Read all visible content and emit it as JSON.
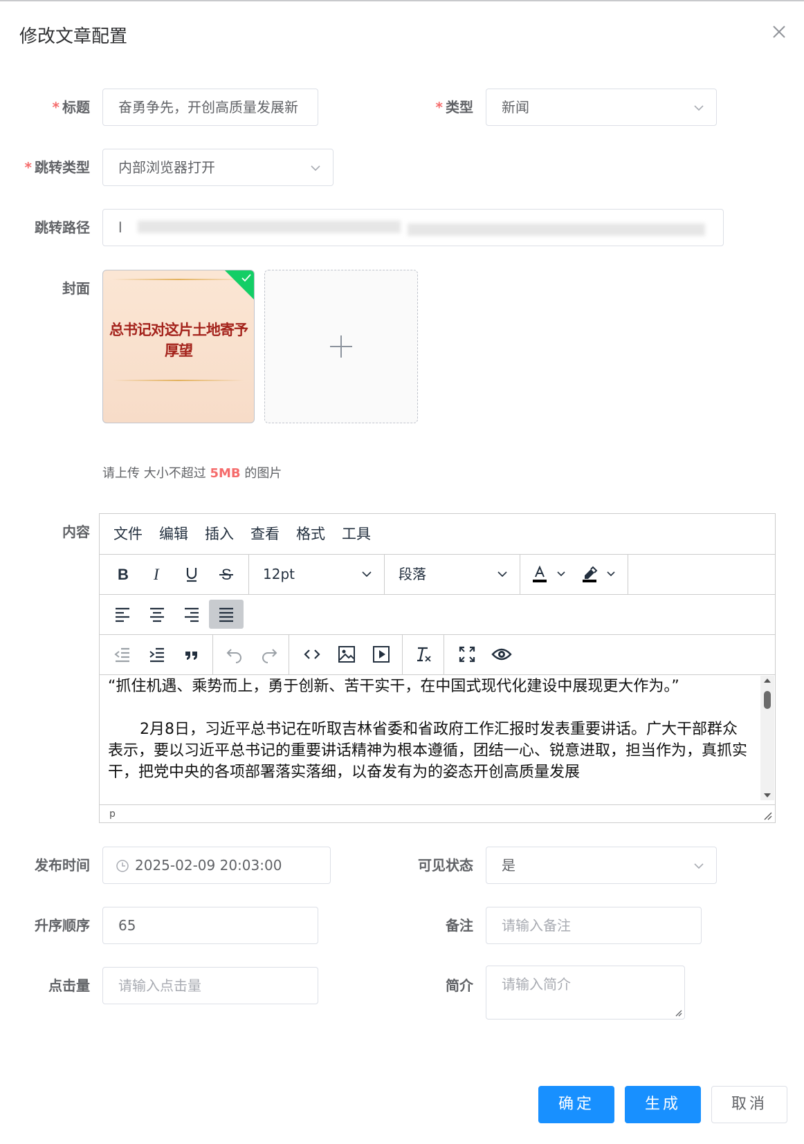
{
  "dialog": {
    "title": "修改文章配置"
  },
  "form": {
    "title_label": "标题",
    "title_value": "奋勇争先，开创高质量发展新",
    "type_label": "类型",
    "type_value": "新闻",
    "jump_type_label": "跳转类型",
    "jump_type_value": "内部浏览器打开",
    "jump_path_label": "跳转路径",
    "jump_path_value": "l",
    "cover_label": "封面",
    "cover_image_text": "总书记对这片土地寄予厚望",
    "upload_tip_prefix": "请上传 大小不超过",
    "upload_tip_size": "5MB",
    "upload_tip_suffix": "的图片",
    "content_label": "内容",
    "publish_time_label": "发布时间",
    "publish_time_value": "2025-02-09 20:03:00",
    "visible_label": "可见状态",
    "visible_value": "是",
    "sort_label": "升序顺序",
    "sort_value": "65",
    "remark_label": "备注",
    "remark_placeholder": "请输入备注",
    "clicks_label": "点击量",
    "clicks_placeholder": "请输入点击量",
    "intro_label": "简介",
    "intro_placeholder": "请输入简介"
  },
  "editor": {
    "menu": [
      "文件",
      "编辑",
      "插入",
      "查看",
      "格式",
      "工具"
    ],
    "font_size": "12pt",
    "block_format": "段落",
    "content_paragraph_1": "“抓住机遇、乘势而上，勇于创新、苦干实干，在中国式现代化建设中展现更大作为。”",
    "content_paragraph_2": "2月8日，习近平总书记在听取吉林省委和省政府工作汇报时发表重要讲话。广大干部群众表示，要以习近平总书记的重要讲话精神为根本遵循，团结一心、锐意进取，担当作为，真抓实干，把党中央的各项部署落实落细，以奋发有为的姿态开创高质量发展",
    "status_path": "p"
  },
  "buttons": {
    "confirm": "确定",
    "generate": "生成",
    "cancel": "取消"
  },
  "colors": {
    "primary": "#1890ff",
    "required": "#f56c6c",
    "cover_badge": "#13ce66"
  },
  "icons": [
    "close-icon",
    "chevron-down-icon",
    "check-icon",
    "plus-icon",
    "clock-icon"
  ]
}
